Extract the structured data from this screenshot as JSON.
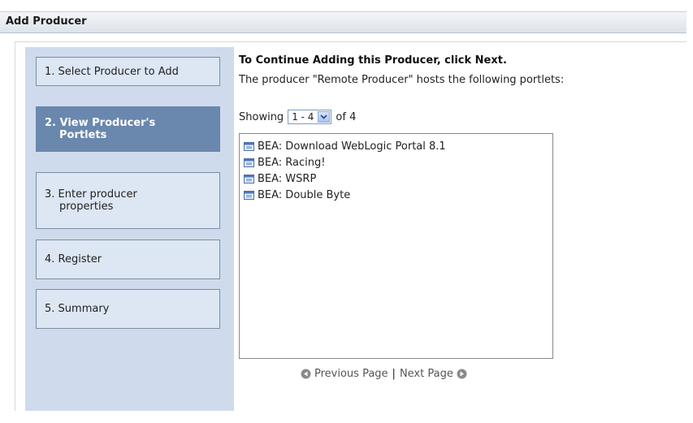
{
  "header": {
    "title": "Add Producer"
  },
  "steps": [
    {
      "label": "1. Select Producer to Add"
    },
    {
      "label_line1": "2. View Producer's",
      "label_line2": "Portlets"
    },
    {
      "label_line1": "3. Enter producer",
      "label_line2": "properties"
    },
    {
      "label": "4. Register"
    },
    {
      "label": "5. Summary"
    }
  ],
  "main": {
    "title": "To Continue Adding this Producer, click Next.",
    "description": "The producer \"Remote Producer\" hosts the following portlets:",
    "showing_label": "Showing",
    "range_value": "1 - 4",
    "of_label": "of 4",
    "portlets": [
      "BEA: Download WebLogic Portal 8.1",
      "BEA: Racing!",
      "BEA: WSRP",
      "BEA: Double Byte"
    ],
    "previous_label": "Previous Page",
    "separator": "|",
    "next_label": "Next Page"
  },
  "icons": {
    "portlet": "window-icon",
    "select_arrow": "chevron-down-icon",
    "previous": "arrow-left-circle-icon",
    "next": "arrow-right-circle-icon"
  },
  "colors": {
    "sidebar_bg": "#cfdbed",
    "active_step": "#6a87ad",
    "step_bg": "#dde6f3"
  }
}
